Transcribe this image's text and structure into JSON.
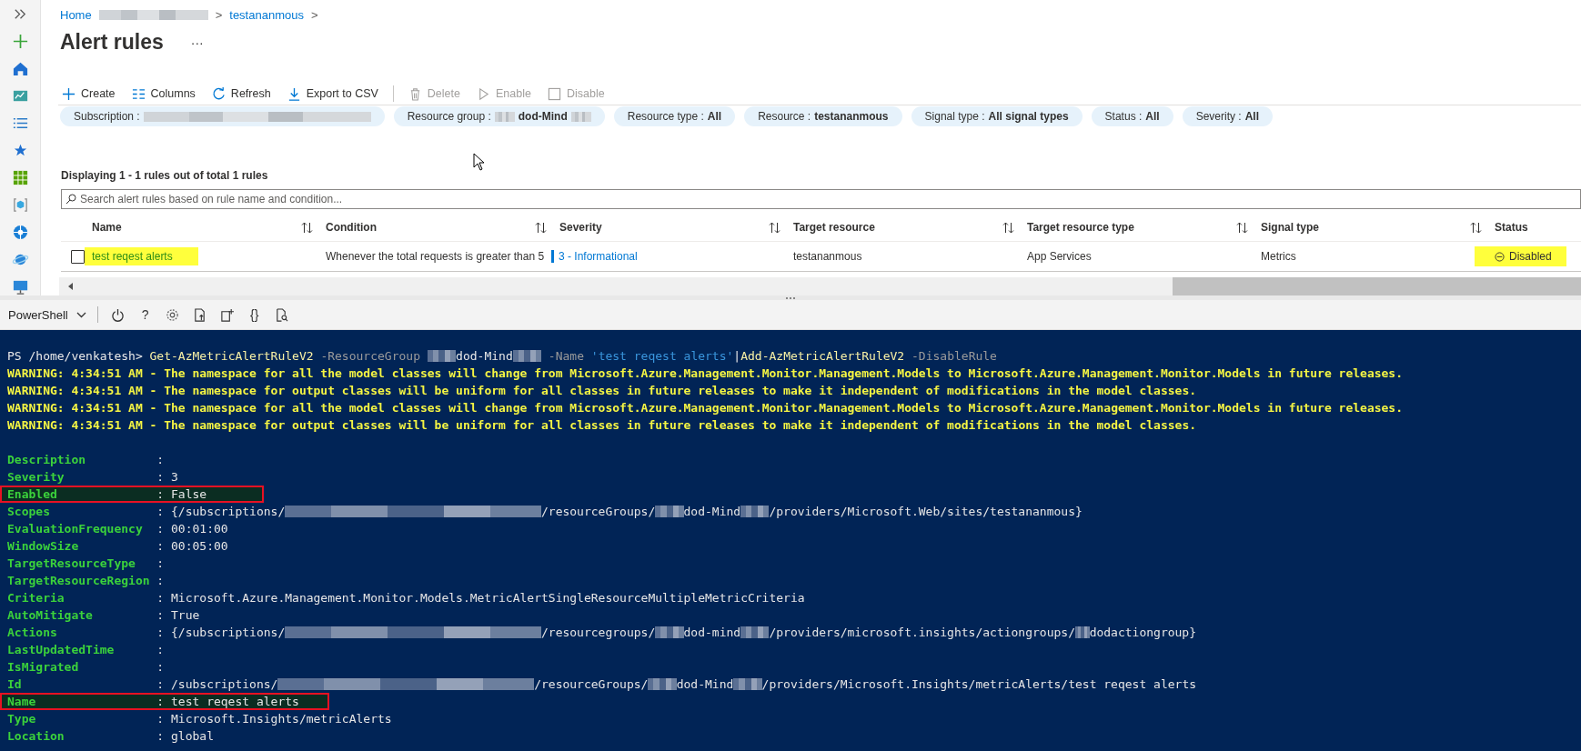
{
  "sidebar": {
    "items": [
      {
        "kind": "expand"
      },
      {
        "kind": "create"
      },
      {
        "kind": "home"
      },
      {
        "kind": "dashboard"
      },
      {
        "kind": "list"
      },
      {
        "kind": "favorites"
      },
      {
        "kind": "grid"
      },
      {
        "kind": "cube"
      },
      {
        "kind": "globe"
      },
      {
        "kind": "planet"
      },
      {
        "kind": "monitor"
      }
    ]
  },
  "breadcrumb": [
    {
      "kind": "link",
      "text": "Home"
    },
    {
      "kind": "redacted-long"
    },
    {
      "kind": "separator",
      "text": ">"
    },
    {
      "kind": "link",
      "text": "testananmous"
    },
    {
      "kind": "separator",
      "text": ">"
    }
  ],
  "page": {
    "title": "Alert rules",
    "more": "···"
  },
  "toolbar": [
    {
      "kind": "create",
      "label": "Create",
      "disabled": false
    },
    {
      "kind": "columns",
      "label": "Columns",
      "disabled": false
    },
    {
      "kind": "refresh",
      "label": "Refresh",
      "disabled": false
    },
    {
      "kind": "export",
      "label": "Export to CSV",
      "disabled": false
    },
    {
      "kind": "separator"
    },
    {
      "kind": "delete",
      "label": "Delete",
      "disabled": true
    },
    {
      "kind": "enable",
      "label": "Enable",
      "disabled": true
    },
    {
      "kind": "disable",
      "label": "Disable",
      "disabled": true
    }
  ],
  "filters": [
    {
      "label": "Subscription :",
      "value": [
        {
          "kind": "redacted-guid"
        }
      ]
    },
    {
      "label": "Resource group :",
      "value": [
        {
          "kind": "redacted-short"
        },
        {
          "kind": "text",
          "text": "dod-Mind"
        },
        {
          "kind": "redacted-short"
        }
      ]
    },
    {
      "label": "Resource type :",
      "value": [
        {
          "kind": "text",
          "text": "All"
        }
      ]
    },
    {
      "label": "Resource :",
      "value": [
        {
          "kind": "text",
          "text": "testananmous"
        }
      ]
    },
    {
      "label": "Signal type :",
      "value": [
        {
          "kind": "text",
          "text": "All signal types"
        }
      ]
    },
    {
      "label": "Status :",
      "value": [
        {
          "kind": "text",
          "text": "All"
        }
      ]
    },
    {
      "label": "Severity :",
      "value": [
        {
          "kind": "text",
          "text": "All"
        }
      ]
    }
  ],
  "summary": "Displaying 1 - 1 rules out of total 1 rules",
  "search": {
    "placeholder": "Search alert rules based on rule name and condition..."
  },
  "table": {
    "columns": [
      {
        "label": "Name",
        "sortable": true
      },
      {
        "label": "Condition",
        "sortable": true
      },
      {
        "label": "Severity",
        "sortable": true
      },
      {
        "label": "Target resource",
        "sortable": true
      },
      {
        "label": "Target resource type",
        "sortable": true
      },
      {
        "label": "Signal type",
        "sortable": true
      },
      {
        "label": "Status",
        "sortable": false
      }
    ],
    "rows": [
      {
        "selected": false,
        "cells": [
          {
            "kind": "link",
            "text": "test reqest alerts",
            "highlighted": true
          },
          {
            "kind": "text",
            "text": "Whenever the total requests is greater than 5",
            "highlighted": false
          },
          {
            "kind": "severity",
            "text": "3 - Informational",
            "highlighted": false
          },
          {
            "kind": "text",
            "text": "testananmous",
            "highlighted": false
          },
          {
            "kind": "text",
            "text": "App Services",
            "highlighted": false
          },
          {
            "kind": "text",
            "text": "Metrics",
            "highlighted": false
          },
          {
            "kind": "status",
            "text": "Disabled",
            "highlighted": true
          }
        ]
      }
    ]
  },
  "shell": {
    "selector": "PowerShell",
    "buttons": [
      {
        "kind": "power"
      },
      {
        "kind": "help",
        "text": "?"
      },
      {
        "kind": "settings"
      },
      {
        "kind": "upload"
      },
      {
        "kind": "new-session"
      },
      {
        "kind": "editor",
        "text": "{}"
      },
      {
        "kind": "preview"
      }
    ]
  },
  "terminal": {
    "command": [
      {
        "kind": "prompt",
        "text": "PS /home/venkatesh> "
      },
      {
        "kind": "cmdlet",
        "text": "Get-AzMetricAlertRuleV2"
      },
      {
        "kind": "param",
        "text": " -ResourceGroup "
      },
      {
        "kind": "redacted-short"
      },
      {
        "kind": "arg",
        "text": "dod-Mind"
      },
      {
        "kind": "redacted-short"
      },
      {
        "kind": "param",
        "text": " -Name "
      },
      {
        "kind": "string",
        "text": "'test reqest alerts'"
      },
      {
        "kind": "arg",
        "text": "|"
      },
      {
        "kind": "cmdlet",
        "text": "Add-AzMetricAlertRuleV2"
      },
      {
        "kind": "param",
        "text": " -DisableRule"
      }
    ],
    "warnings": [
      "WARNING: 4:34:51 AM - The namespace for all the model classes will change from Microsoft.Azure.Management.Monitor.Management.Models to Microsoft.Azure.Management.Monitor.Models in future releases.",
      "WARNING: 4:34:51 AM - The namespace for output classes will be uniform for all classes in future releases to make it independent of modifications in the model classes.",
      "WARNING: 4:34:51 AM - The namespace for all the model classes will change from Microsoft.Azure.Management.Monitor.Management.Models to Microsoft.Azure.Management.Monitor.Models in future releases.",
      "WARNING: 4:34:51 AM - The namespace for output classes will be uniform for all classes in future releases to make it independent of modifications in the model classes."
    ],
    "properties": [
      {
        "label": "Description",
        "highlighted": false,
        "value": [
          {
            "kind": "text",
            "text": ":"
          }
        ]
      },
      {
        "label": "Severity",
        "highlighted": false,
        "value": [
          {
            "kind": "text",
            "text": ": 3"
          }
        ]
      },
      {
        "label": "Enabled",
        "highlighted": true,
        "value": [
          {
            "kind": "text",
            "text": ": False"
          }
        ]
      },
      {
        "label": "Scopes",
        "highlighted": false,
        "value": [
          {
            "kind": "text",
            "text": ": {/subscriptions/"
          },
          {
            "kind": "redacted-guid"
          },
          {
            "kind": "text",
            "text": "/resourceGroups/"
          },
          {
            "kind": "redacted-short"
          },
          {
            "kind": "text",
            "text": "dod-Mind"
          },
          {
            "kind": "redacted-short"
          },
          {
            "kind": "text",
            "text": "/providers/Microsoft.Web/sites/testananmous}"
          }
        ]
      },
      {
        "label": "EvaluationFrequency",
        "highlighted": false,
        "value": [
          {
            "kind": "text",
            "text": ": 00:01:00"
          }
        ]
      },
      {
        "label": "WindowSize",
        "highlighted": false,
        "value": [
          {
            "kind": "text",
            "text": ": 00:05:00"
          }
        ]
      },
      {
        "label": "TargetResourceType",
        "highlighted": false,
        "value": [
          {
            "kind": "text",
            "text": ":"
          }
        ]
      },
      {
        "label": "TargetResourceRegion",
        "highlighted": false,
        "value": [
          {
            "kind": "text",
            "text": ":"
          }
        ]
      },
      {
        "label": "Criteria",
        "highlighted": false,
        "value": [
          {
            "kind": "text",
            "text": ": Microsoft.Azure.Management.Monitor.Models.MetricAlertSingleResourceMultipleMetricCriteria"
          }
        ]
      },
      {
        "label": "AutoMitigate",
        "highlighted": false,
        "value": [
          {
            "kind": "text",
            "text": ": True"
          }
        ]
      },
      {
        "label": "Actions",
        "highlighted": false,
        "value": [
          {
            "kind": "text",
            "text": ": {/subscriptions/"
          },
          {
            "kind": "redacted-guid"
          },
          {
            "kind": "text",
            "text": "/resourcegroups/"
          },
          {
            "kind": "redacted-short"
          },
          {
            "kind": "text",
            "text": "dod-mind"
          },
          {
            "kind": "redacted-short"
          },
          {
            "kind": "text",
            "text": "/providers/microsoft.insights/actiongroups/"
          },
          {
            "kind": "redacted-tiny"
          },
          {
            "kind": "text",
            "text": "dodactiongroup}"
          }
        ]
      },
      {
        "label": "LastUpdatedTime",
        "highlighted": false,
        "value": [
          {
            "kind": "text",
            "text": ":"
          }
        ]
      },
      {
        "label": "IsMigrated",
        "highlighted": false,
        "value": [
          {
            "kind": "text",
            "text": ":"
          }
        ]
      },
      {
        "label": "Id",
        "highlighted": false,
        "value": [
          {
            "kind": "text",
            "text": ": /subscriptions/"
          },
          {
            "kind": "redacted-guid"
          },
          {
            "kind": "text",
            "text": "/resourceGroups/"
          },
          {
            "kind": "redacted-short"
          },
          {
            "kind": "text",
            "text": "dod-Mind"
          },
          {
            "kind": "redacted-short"
          },
          {
            "kind": "text",
            "text": "/providers/Microsoft.Insights/metricAlerts/test reqest alerts"
          }
        ]
      },
      {
        "label": "Name",
        "highlighted": true,
        "value": [
          {
            "kind": "text",
            "text": ": test reqest alerts"
          }
        ]
      },
      {
        "label": "Type",
        "highlighted": false,
        "value": [
          {
            "kind": "text",
            "text": ": Microsoft.Insights/metricAlerts"
          }
        ]
      },
      {
        "label": "Location",
        "highlighted": false,
        "value": [
          {
            "kind": "text",
            "text": ": global"
          }
        ]
      }
    ]
  }
}
